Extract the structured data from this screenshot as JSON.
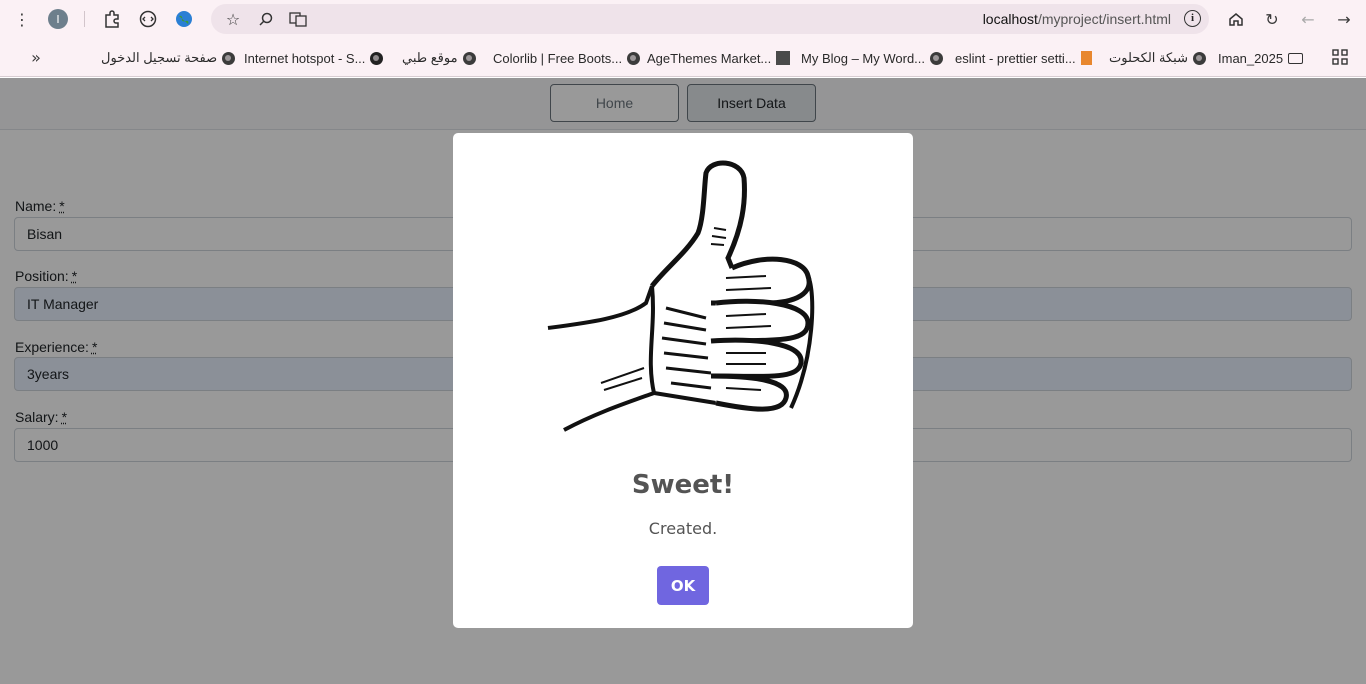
{
  "browser": {
    "profile_initial": "I",
    "url_host": "localhost",
    "url_path": "/myproject/insert.html",
    "bookmarks": [
      "صفحة تسجيل الدخول",
      "Internet hotspot - S...",
      "موقع طبي",
      "Colorlib | Free Boots...",
      "AgeThemes Market...",
      "My Blog – My Word...",
      "eslint - prettier setti...",
      "شبكة الكحلوت",
      "Iman_2025"
    ]
  },
  "nav": {
    "home_label": "Home",
    "insert_label": "Insert Data"
  },
  "form": {
    "required_mark": "*",
    "name_label": "Name:",
    "name_value": "Bisan",
    "position_label": "Position:",
    "position_value": "IT Manager",
    "experience_label": "Experience:",
    "experience_value": "3years",
    "salary_label": "Salary:",
    "salary_value": "1000"
  },
  "modal": {
    "title": "Sweet!",
    "text": "Created.",
    "ok_label": "OK",
    "ok_color": "#7066e0"
  }
}
